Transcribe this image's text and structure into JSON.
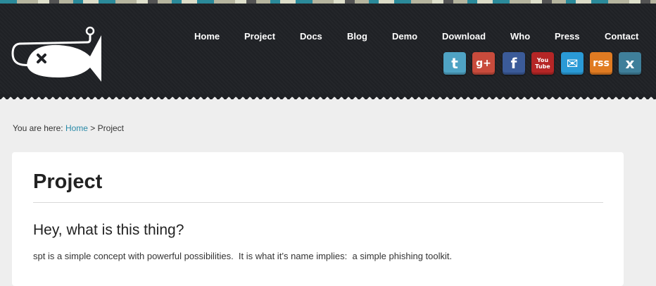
{
  "nav": {
    "items": [
      "Home",
      "Project",
      "Docs",
      "Blog",
      "Demo",
      "Download",
      "Who",
      "Press",
      "Contact"
    ]
  },
  "social": {
    "items": [
      {
        "name": "twitter-icon",
        "color": "#4fa3c4",
        "glyph": "t"
      },
      {
        "name": "google-plus-icon",
        "color": "#c84b3c",
        "glyph": "g+"
      },
      {
        "name": "facebook-icon",
        "color": "#3b5b99",
        "glyph": "f"
      },
      {
        "name": "youtube-icon",
        "color": "#b52626",
        "glyph": "You Tube"
      },
      {
        "name": "email-icon",
        "color": "#2a9ad6",
        "glyph": "✉"
      },
      {
        "name": "rss-icon",
        "color": "#e07b22",
        "glyph": "rss"
      },
      {
        "name": "xing-icon",
        "color": "#3f7f9a",
        "glyph": "x"
      }
    ]
  },
  "breadcrumb": {
    "prefix": "You are here: ",
    "home": "Home",
    "separator": " > ",
    "current": "Project"
  },
  "content": {
    "title": "Project",
    "subtitle": "Hey, what is this thing?",
    "paragraph": "spt is a simple concept with powerful possibilities.  It is what it’s name implies:  a simple phishing toolkit."
  }
}
